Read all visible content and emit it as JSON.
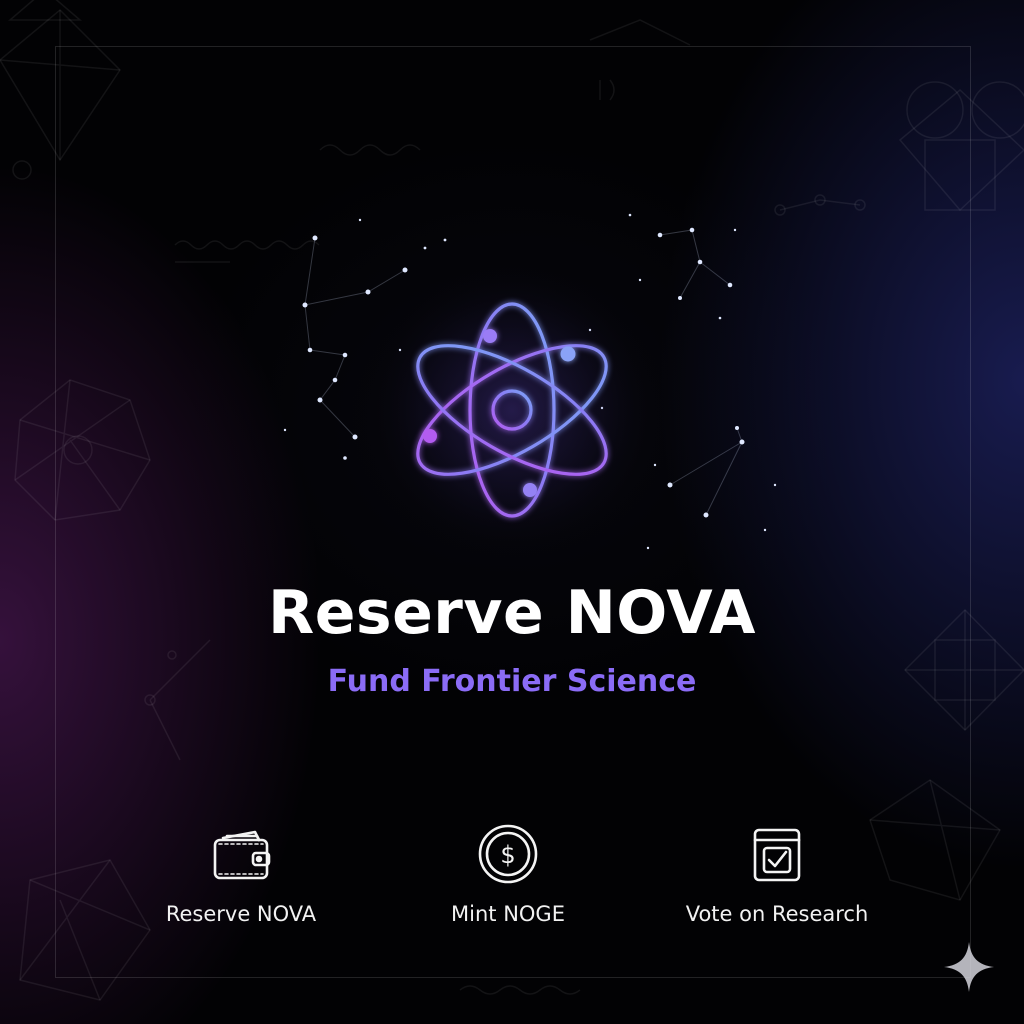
{
  "hero": {
    "title": "Reserve NOVA",
    "subtitle": "Fund Frontier Science",
    "logo_icon": "atom-icon",
    "accent_color": "#8b6cf6"
  },
  "actions": [
    {
      "label": "Reserve NOVA",
      "icon": "wallet-icon"
    },
    {
      "label": "Mint NOGE",
      "icon": "dollar-coin-icon"
    },
    {
      "label": "Vote on Research",
      "icon": "checkbox-calendar-icon"
    }
  ],
  "decor": {
    "corner_icon": "sparkle-icon",
    "background": "constellation-and-geometry-pattern"
  }
}
